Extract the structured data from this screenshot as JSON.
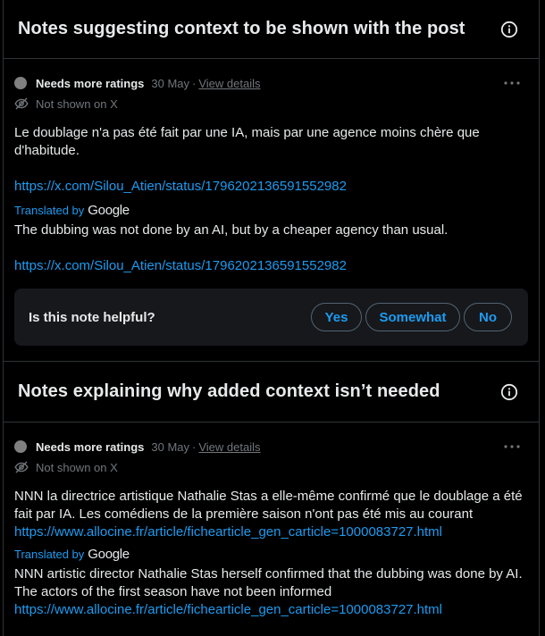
{
  "section1": {
    "title": "Notes suggesting context to be shown with the post",
    "note": {
      "status": "Needs more ratings",
      "date": "30 May",
      "separator": "·",
      "view_details": "View details",
      "visibility": "Not shown on X",
      "original_text": "Le doublage n'a pas été fait par une IA, mais par une agence moins chère que d'habitude.",
      "original_link": "https://x.com/Silou_Atien/status/1796202136591552982",
      "translated_by": "Translated by",
      "translator": "Google",
      "translated_text": "The dubbing was not done by an AI, but by a cheaper agency than usual.",
      "translated_link": "https://x.com/Silou_Atien/status/1796202136591552982"
    },
    "helpful": {
      "question": "Is this note helpful?",
      "yes": "Yes",
      "somewhat": "Somewhat",
      "no": "No"
    }
  },
  "section2": {
    "title": "Notes explaining why added context isn’t needed",
    "note": {
      "status": "Needs more ratings",
      "date": "30 May",
      "separator": "·",
      "view_details": "View details",
      "visibility": "Not shown on X",
      "original_text": "NNN la directrice artistique Nathalie Stas a elle-même confirmé que le doublage a été fait par IA. Les comédiens de la première saison n'ont pas été mis au courant",
      "original_link": "https://www.allocine.fr/article/fichearticle_gen_carticle=1000083727.html",
      "translated_by": "Translated by",
      "translator": "Google",
      "translated_text": "NNN artistic director Nathalie Stas herself confirmed that the dubbing was done by AI. The actors of the first season have not been informed",
      "translated_link": "https://www.allocine.fr/article/fichearticle_gen_carticle=1000083727.html"
    }
  },
  "icons": {
    "info": "info-circle-icon",
    "more": "more-horizontal-icon",
    "hidden": "eye-off-icon"
  },
  "colors": {
    "background": "#000000",
    "text": "#e7e9ea",
    "muted": "#71767b",
    "link": "#1d9bf0",
    "border": "#2f3336",
    "panel": "#16181c",
    "status_dot": "#808080"
  }
}
